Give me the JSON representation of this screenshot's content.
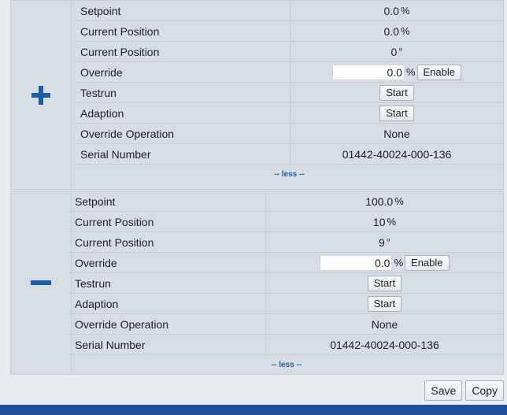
{
  "panel_top": {
    "rows": [
      {
        "label": "Setpoint",
        "value": "0.0",
        "unit": "%"
      },
      {
        "label": "Current Position",
        "value": "0.0",
        "unit": "%"
      },
      {
        "label": "Current Position",
        "value": "0",
        "unit": "°"
      },
      {
        "label": "Override",
        "value": "0.0",
        "unit": "%",
        "button": "Enable"
      },
      {
        "label": "Testrun",
        "button": "Start"
      },
      {
        "label": "Adaption",
        "button": "Start"
      },
      {
        "label": "Override Operation",
        "value": "None"
      },
      {
        "label": "Serial Number",
        "value": "01442-40024-000-136"
      }
    ],
    "less_label": "-- less --"
  },
  "panel_bottom": {
    "rows": [
      {
        "label": "Setpoint",
        "value": "100.0",
        "unit": "%"
      },
      {
        "label": "Current Position",
        "value": "10",
        "unit": "%"
      },
      {
        "label": "Current Position",
        "value": "9",
        "unit": "°"
      },
      {
        "label": "Override",
        "value": "0.0",
        "unit": "%",
        "button": "Enable"
      },
      {
        "label": "Testrun",
        "button": "Start"
      },
      {
        "label": "Adaption",
        "button": "Start"
      },
      {
        "label": "Override Operation",
        "value": "None"
      },
      {
        "label": "Serial Number",
        "value": "01442-40024-000-136"
      }
    ],
    "less_label": "-- less --"
  },
  "footer": {
    "save_label": "Save",
    "copy_label": "Copy"
  },
  "icons": {
    "expand": "plus-icon",
    "collapse": "minus-icon"
  },
  "colors": {
    "accent": "#1d5da8",
    "bottom_bar": "#1f4fa0",
    "panel_bg": "#d6dde4"
  }
}
